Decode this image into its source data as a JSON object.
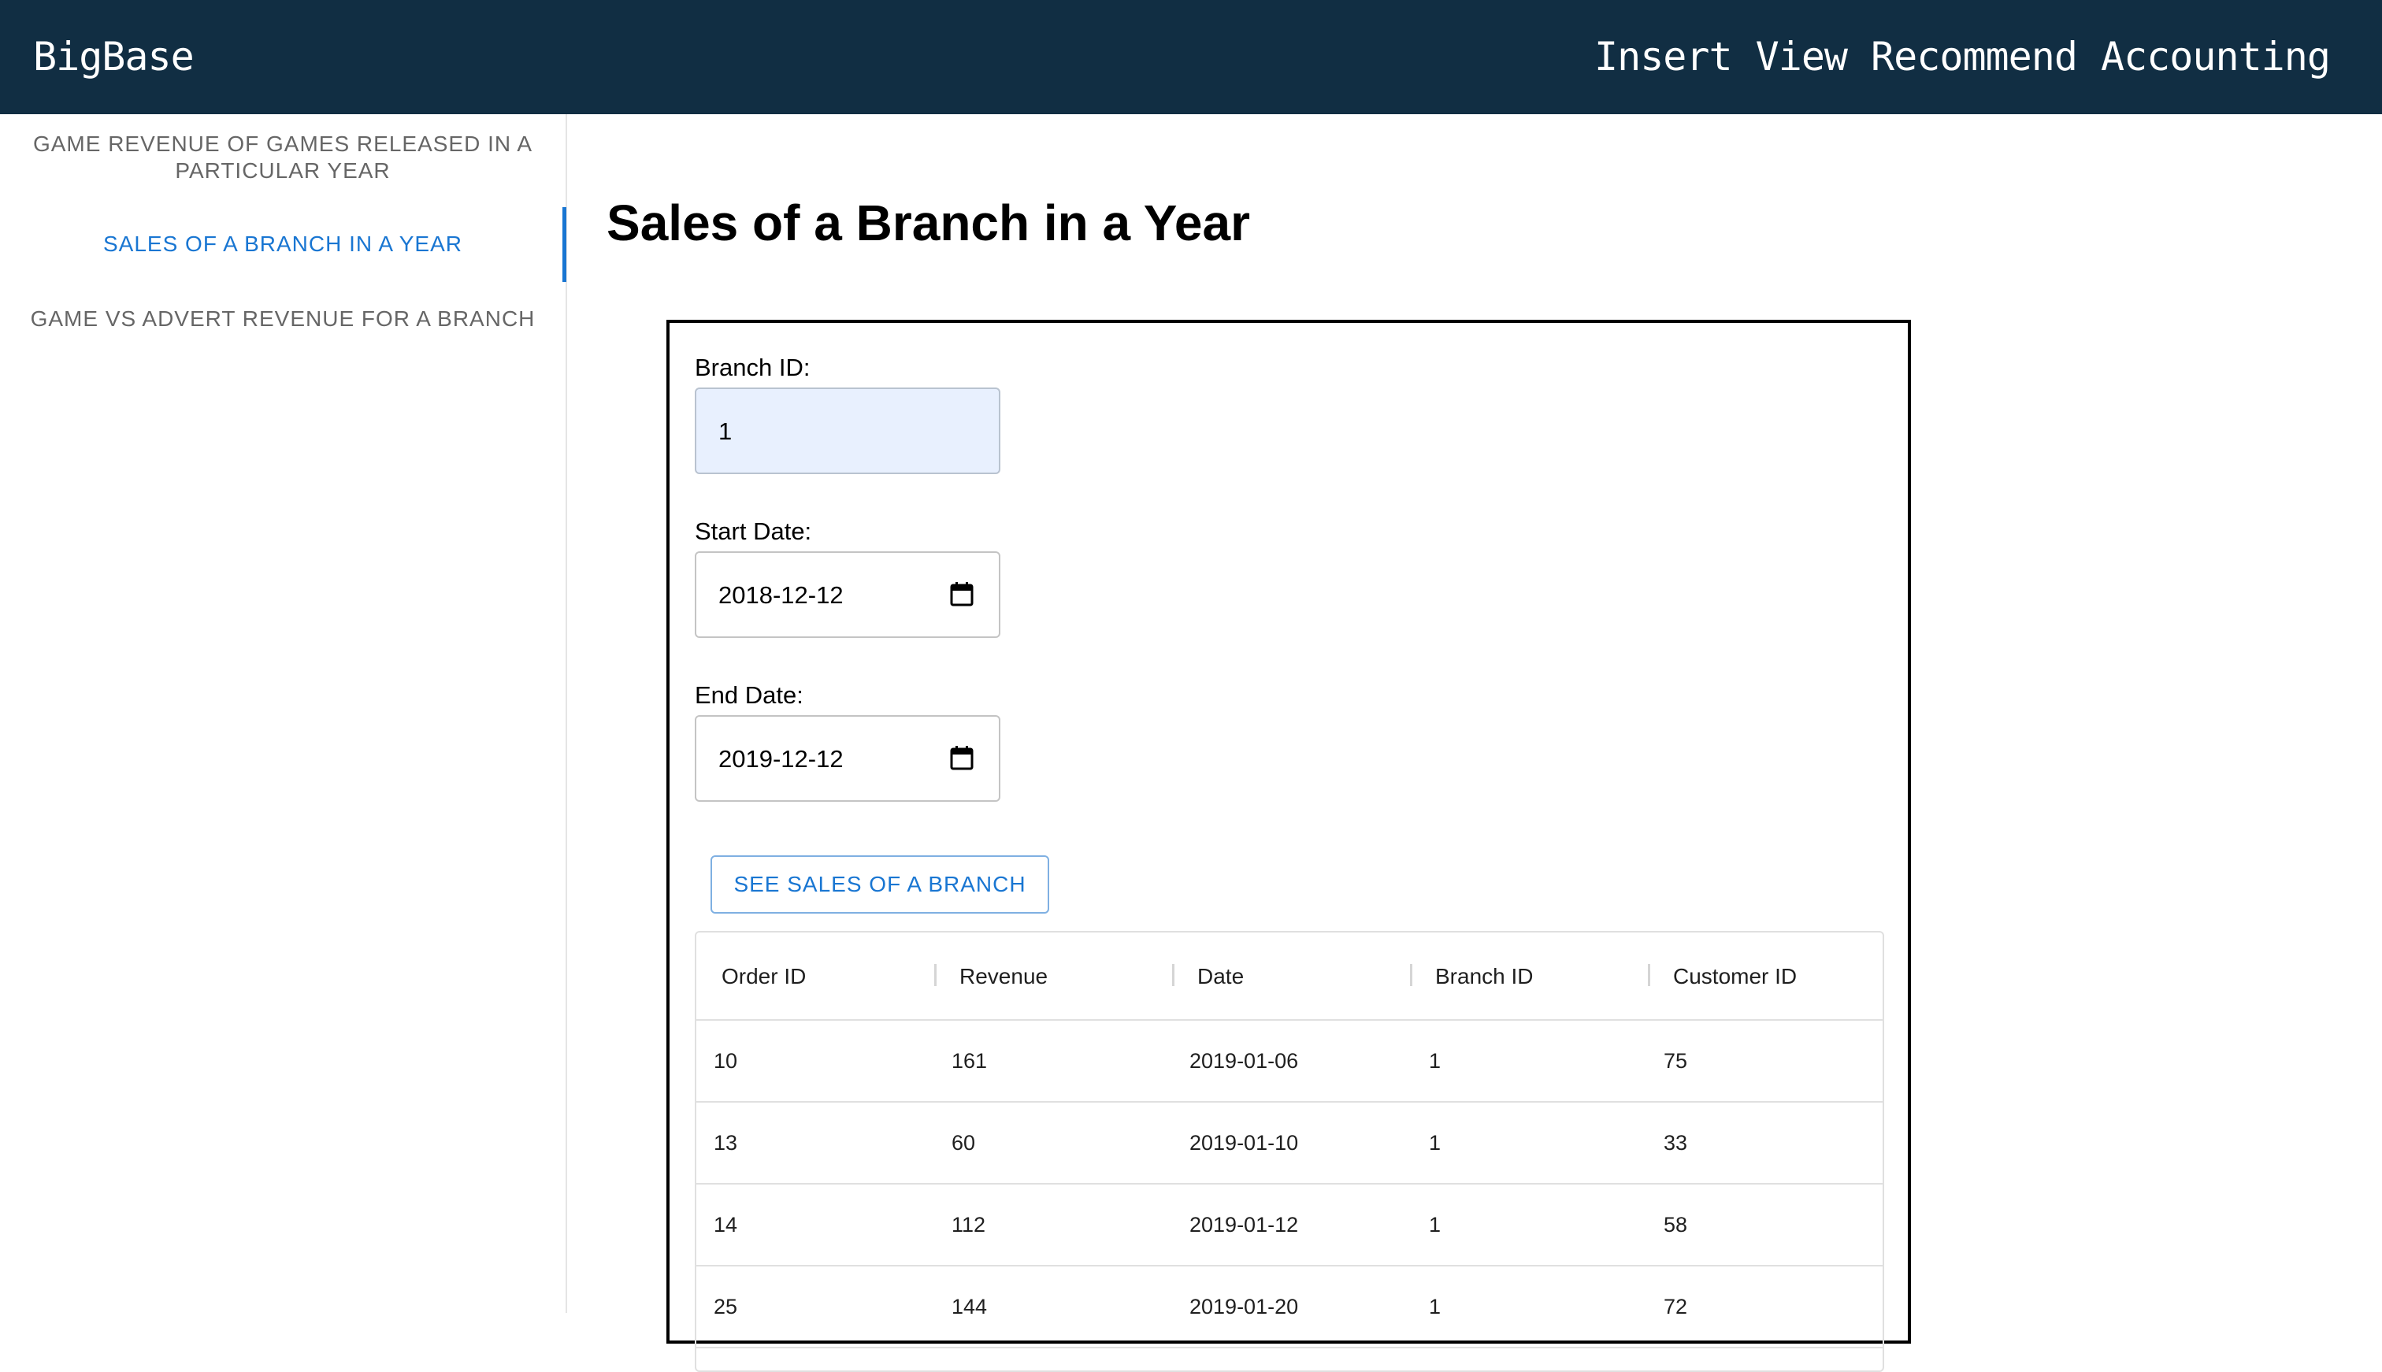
{
  "app": {
    "brand": "BigBase",
    "nav": [
      "Insert",
      "View",
      "Recommend",
      "Accounting"
    ]
  },
  "sidebar": {
    "items": [
      {
        "label": "GAME REVENUE OF GAMES RELEASED IN A PARTICULAR YEAR",
        "active": false
      },
      {
        "label": "SALES OF A BRANCH IN A YEAR",
        "active": true
      },
      {
        "label": "GAME VS ADVERT REVENUE FOR A BRANCH",
        "active": false
      }
    ]
  },
  "main": {
    "title": "Sales of a Branch in a Year",
    "form": {
      "branch_label": "Branch ID:",
      "branch_value": "1",
      "start_label": "Start Date:",
      "start_value": "2018-12-12",
      "end_label": "End Date:",
      "end_value": "2019-12-12",
      "submit_label": "SEE SALES OF A BRANCH"
    },
    "table": {
      "columns": [
        "Order ID",
        "Revenue",
        "Date",
        "Branch ID",
        "Customer ID"
      ],
      "rows": [
        [
          "10",
          "161",
          "2019-01-06",
          "1",
          "75"
        ],
        [
          "13",
          "60",
          "2019-01-10",
          "1",
          "33"
        ],
        [
          "14",
          "112",
          "2019-01-12",
          "1",
          "58"
        ],
        [
          "25",
          "144",
          "2019-01-20",
          "1",
          "72"
        ]
      ]
    }
  },
  "colors": {
    "topbar": "#112e43",
    "accent": "#1976d2",
    "filled_input": "#e8f0fe"
  }
}
